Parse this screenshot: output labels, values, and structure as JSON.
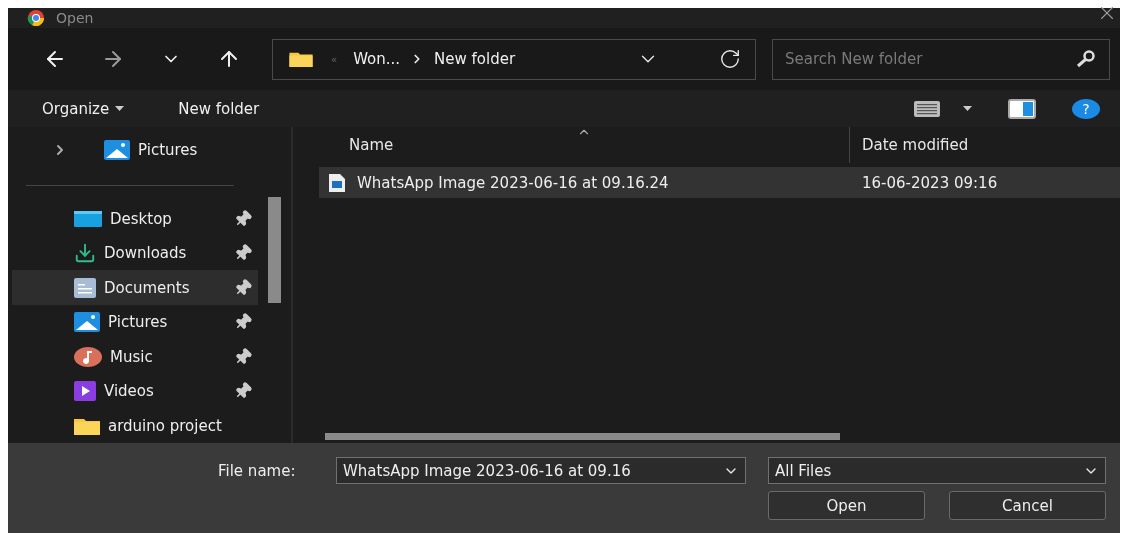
{
  "window": {
    "title": "Open"
  },
  "navigation": {
    "overflow": "«",
    "breadcrumb": [
      {
        "label": "Won..."
      },
      {
        "label": "New folder"
      }
    ]
  },
  "search": {
    "placeholder": "Search New folder"
  },
  "help": {
    "label": "?"
  },
  "command_bar": [
    {
      "label": "Organize",
      "kind": "menu"
    },
    {
      "label": "New folder",
      "kind": "button"
    }
  ],
  "tree": [
    {
      "label": "Pictures",
      "kind": "pictures",
      "expanded": false
    }
  ],
  "quick_access": [
    {
      "label": "Desktop",
      "kind": "desktop",
      "pinned": true,
      "selected": false
    },
    {
      "label": "Downloads",
      "kind": "downloads",
      "pinned": true,
      "selected": false
    },
    {
      "label": "Documents",
      "kind": "documents",
      "pinned": true,
      "selected": true
    },
    {
      "label": "Pictures",
      "kind": "pictures",
      "pinned": true,
      "selected": false
    },
    {
      "label": "Music",
      "kind": "music",
      "pinned": true,
      "selected": false
    },
    {
      "label": "Videos",
      "kind": "videos",
      "pinned": true,
      "selected": false
    },
    {
      "label": "arduino project",
      "kind": "folder",
      "pinned": false,
      "selected": false
    }
  ],
  "columns": [
    {
      "label": "Name",
      "sorted": true
    },
    {
      "label": "Date modified",
      "sorted": false
    }
  ],
  "files": [
    {
      "name": "WhatsApp Image 2023-06-16 at 09.16.24",
      "date": "16-06-2023 09:16",
      "selected": true
    }
  ],
  "footer": {
    "file_name_label": "File name:",
    "file_name": "WhatsApp Image 2023-06-16 at 09.16",
    "file_type": "All Files",
    "buttons": [
      {
        "label": "Open"
      },
      {
        "label": "Cancel"
      }
    ]
  }
}
